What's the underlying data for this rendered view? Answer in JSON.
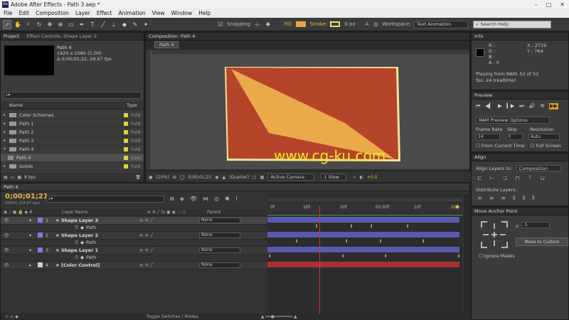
{
  "window": {
    "title": "Adobe After Effects - Path 3.aep *",
    "minimize": "–",
    "maximize": "□",
    "close": "✕",
    "logo": "Ae"
  },
  "menu": [
    "File",
    "Edit",
    "Composition",
    "Layer",
    "Effect",
    "Animation",
    "View",
    "Window",
    "Help"
  ],
  "toolbar": {
    "snapping_label": "Snapping",
    "fill_label": "Fill:",
    "fill_color": "#e8a640",
    "stroke_label": "Stroke:",
    "stroke_color": "#f0e060",
    "stroke_px": "0 px",
    "a_label": "A",
    "workspace_label": "Workspace:",
    "workspace_value": "Text Animation",
    "search_placeholder": "Search Help"
  },
  "project": {
    "tabs": [
      "Project",
      "Effect Controls: Shape Layer 3"
    ],
    "selected_name": "Path 4",
    "selected_res": "1920 x 1080 (1.00)",
    "selected_dur": "Δ 0;00;01;22, 29.97 fps",
    "col_name": "Name",
    "col_type": "Type",
    "items": [
      {
        "name": "Color Schemes",
        "type": "Fold",
        "kind": "folder"
      },
      {
        "name": "Path 1",
        "type": "Fold",
        "kind": "folder"
      },
      {
        "name": "Path 2",
        "type": "Fold",
        "kind": "folder"
      },
      {
        "name": "Path 3",
        "type": "Fold",
        "kind": "folder"
      },
      {
        "name": "Path 4",
        "type": "Fold",
        "kind": "folder"
      },
      {
        "name": "Path 4",
        "type": "Com",
        "kind": "comp"
      },
      {
        "name": "Solids",
        "type": "Fold",
        "kind": "folder"
      }
    ],
    "bpc": "8 bpc"
  },
  "comp": {
    "tab": "Composition: Path 4",
    "breadcrumb": "Path 4",
    "zoom": "(20%)",
    "time": "0;00;01;21",
    "resolution": "(Quarter)",
    "camera": "Active Camera",
    "views": "1 View",
    "exposure": "+0.0",
    "bg_color": "#b5452a",
    "shape_color": "#eba94a",
    "frame_color": "#f3e39c",
    "watermark": "www.cg-ku.com"
  },
  "info": {
    "tab": "Info",
    "r": "R :",
    "g": "G :",
    "b": "B :",
    "a": "A : 0",
    "x": "X : 2719",
    "y": "Y : 764",
    "playing": "Playing from RAM: 52 of 52",
    "fps": "fps: 24 (realtime)"
  },
  "preview": {
    "tab": "Preview",
    "ram_options": "RAM Preview Options",
    "frame_rate_label": "Frame Rate",
    "skip_label": "Skip",
    "resolution_label": "Resolution",
    "frame_rate": "24",
    "skip": "0",
    "resolution": "Auto",
    "from_current": "From Current Time",
    "full_screen": "Full Screen"
  },
  "align": {
    "tab": "Align",
    "align_to_label": "Align Layers to:",
    "align_to": "Composition",
    "distribute": "Distribute Layers:"
  },
  "anchor": {
    "tab": "Move Anchor Point",
    "value": ".5",
    "move_btn": "Move to Custom",
    "ignore_masks": "Ignore Masks"
  },
  "timeline": {
    "tab": "Path 4",
    "timecode": "0;00;01;21",
    "frames": "00051 (29.97 fps)",
    "col_layer": "Layer Name",
    "col_parent": "Parent",
    "ruler": [
      "0f",
      "10f",
      "20f",
      "01:00f",
      "10f",
      "20f"
    ],
    "toggle": "Toggle Switches / Modes",
    "layers": [
      {
        "num": "1",
        "name": "Shape Layer 3",
        "sub": "Path",
        "color": "#7c7ce0",
        "parent": "None"
      },
      {
        "num": "2",
        "name": "Shape Layer 2",
        "sub": "Path",
        "color": "#7c7ce0",
        "parent": "None"
      },
      {
        "num": "3",
        "name": "Shape Layer 1",
        "sub": "Path",
        "color": "#7c7ce0",
        "parent": "None"
      },
      {
        "num": "4",
        "name": "[Color Control]",
        "sub": "",
        "color": "#d0d0d0",
        "parent": "None"
      }
    ],
    "keyframe_glyph": "I"
  }
}
